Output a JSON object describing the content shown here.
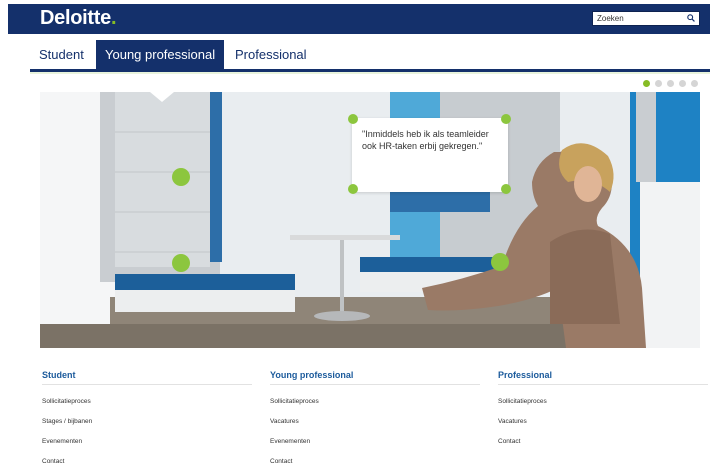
{
  "header": {
    "logo": "Deloitte",
    "search_label": "Zoeken"
  },
  "tabs": [
    {
      "label": "Student"
    },
    {
      "label": "Young professional"
    },
    {
      "label": "Professional"
    }
  ],
  "hero": {
    "quote": "\"Inmiddels heb ik als teamleider ook HR-taken erbij gekregen.\"",
    "slides_total": 5,
    "active_slide": 1
  },
  "footer": [
    {
      "heading": "Student",
      "links": [
        "Sollicitatieproces",
        "Stages / bijbanen",
        "Evenementen",
        "Contact"
      ]
    },
    {
      "heading": "Young professional",
      "links": [
        "Sollicitatieproces",
        "Vacatures",
        "Evenementen",
        "Contact"
      ]
    },
    {
      "heading": "Professional",
      "links": [
        "Sollicitatieproces",
        "Vacatures",
        "Contact"
      ]
    }
  ],
  "colors": {
    "brand_navy": "#14306b",
    "brand_green": "#86bc25",
    "link_blue": "#1c5b9c"
  }
}
